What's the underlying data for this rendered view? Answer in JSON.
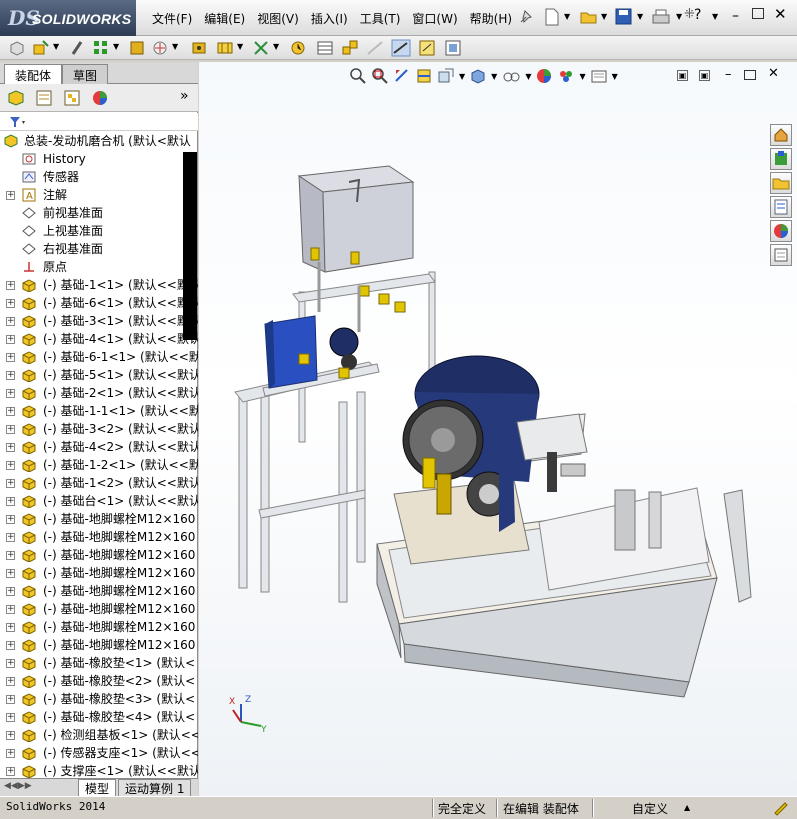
{
  "app": {
    "logo_ds": "DS",
    "logo_text": "SOLIDWORKS"
  },
  "menu": {
    "items": [
      "文件(F)",
      "编辑(E)",
      "视图(V)",
      "插入(I)",
      "工具(T)",
      "窗口(W)",
      "帮助(H)"
    ]
  },
  "left_panel": {
    "tabs": [
      "装配体",
      "草图"
    ],
    "bottom_tabs": [
      "模型",
      "运动算例 1"
    ],
    "root_label": "总装-发动机磨合机  (默认<默认",
    "tree_items": [
      {
        "label": "History",
        "icon": "history-icon",
        "expand": false
      },
      {
        "label": "传感器",
        "icon": "sensor-icon",
        "expand": false
      },
      {
        "label": "注解",
        "icon": "annotation-icon",
        "expand": true
      },
      {
        "label": "前视基准面",
        "icon": "plane-icon",
        "expand": false
      },
      {
        "label": "上视基准面",
        "icon": "plane-icon",
        "expand": false
      },
      {
        "label": "右视基准面",
        "icon": "plane-icon",
        "expand": false
      },
      {
        "label": "原点",
        "icon": "origin-icon",
        "expand": false
      },
      {
        "label": "(-) 基础-1<1>  (默认<<默认",
        "icon": "part-icon",
        "expand": true
      },
      {
        "label": "(-) 基础-6<1>  (默认<<默认",
        "icon": "part-icon",
        "expand": true
      },
      {
        "label": "(-) 基础-3<1>  (默认<<默认",
        "icon": "part-icon",
        "expand": true
      },
      {
        "label": "(-) 基础-4<1>  (默认<<默认",
        "icon": "part-icon",
        "expand": true
      },
      {
        "label": "(-) 基础-6-1<1>  (默认<<默",
        "icon": "part-icon",
        "expand": true
      },
      {
        "label": "(-) 基础-5<1>  (默认<<默认",
        "icon": "part-icon",
        "expand": true
      },
      {
        "label": "(-) 基础-2<1>  (默认<<默认",
        "icon": "part-icon",
        "expand": true
      },
      {
        "label": "(-) 基础-1-1<1>  (默认<<默",
        "icon": "part-icon",
        "expand": true
      },
      {
        "label": "(-) 基础-3<2>  (默认<<默认",
        "icon": "part-icon",
        "expand": true
      },
      {
        "label": "(-) 基础-4<2>  (默认<<默认",
        "icon": "part-icon",
        "expand": true
      },
      {
        "label": "(-) 基础-1-2<1>  (默认<<默",
        "icon": "part-icon",
        "expand": true
      },
      {
        "label": "(-) 基础-1<2>  (默认<<默认",
        "icon": "part-icon",
        "expand": true
      },
      {
        "label": "(-) 基础台<1>  (默认<<默认",
        "icon": "part-icon",
        "expand": true
      },
      {
        "label": "(-) 基础-地脚螺栓M12×160",
        "icon": "part-icon",
        "expand": true
      },
      {
        "label": "(-) 基础-地脚螺栓M12×160",
        "icon": "part-icon",
        "expand": true
      },
      {
        "label": "(-) 基础-地脚螺栓M12×160",
        "icon": "part-icon",
        "expand": true
      },
      {
        "label": "(-) 基础-地脚螺栓M12×160",
        "icon": "part-icon",
        "expand": true
      },
      {
        "label": "(-) 基础-地脚螺栓M12×160",
        "icon": "part-icon",
        "expand": true
      },
      {
        "label": "(-) 基础-地脚螺栓M12×160",
        "icon": "part-icon",
        "expand": true
      },
      {
        "label": "(-) 基础-地脚螺栓M12×160",
        "icon": "part-icon",
        "expand": true
      },
      {
        "label": "(-) 基础-地脚螺栓M12×160",
        "icon": "part-icon",
        "expand": true
      },
      {
        "label": "(-) 基础-橡胶垫<1>  (默认<",
        "icon": "part-icon",
        "expand": true
      },
      {
        "label": "(-) 基础-橡胶垫<2>  (默认<",
        "icon": "part-icon",
        "expand": true
      },
      {
        "label": "(-) 基础-橡胶垫<3>  (默认<",
        "icon": "part-icon",
        "expand": true
      },
      {
        "label": "(-) 基础-橡胶垫<4>  (默认<",
        "icon": "part-icon",
        "expand": true
      },
      {
        "label": "(-) 检测组基板<1>  (默认<<",
        "icon": "part-icon",
        "expand": true
      },
      {
        "label": "(-) 传感器支座<1>  (默认<<",
        "icon": "part-icon",
        "expand": true
      },
      {
        "label": "(-) 支撑座<1>  (默认<<默认",
        "icon": "part-icon",
        "expand": true
      }
    ]
  },
  "status": {
    "app_version": "SolidWorks 2014",
    "definition": "完全定义",
    "editing": "在编辑 装配体",
    "units": "自定义"
  },
  "colors": {
    "motor_blue": "#1f2f66",
    "frame_grey": "#c9cfd6",
    "tank_grey": "#cfd1da",
    "base_plate": "#e8e0cf",
    "valve_yellow": "#e2c400",
    "pump_blue": "#2a4fc0"
  }
}
